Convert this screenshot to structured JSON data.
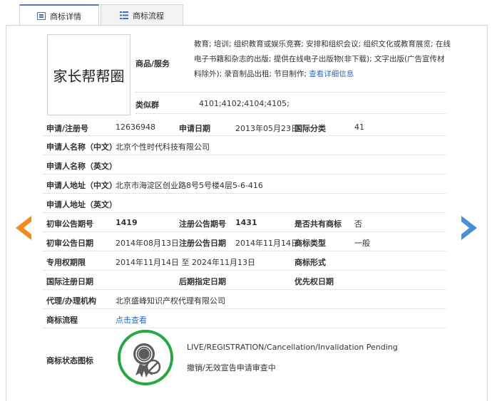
{
  "tabs": [
    {
      "label": "商标详情",
      "icon": "document-icon",
      "active": true
    },
    {
      "label": "商标流程",
      "icon": "list-icon",
      "active": false
    }
  ],
  "trademark": {
    "logo_text": "家长帮帮圈",
    "goods_services_label": "商品/服务",
    "goods_services_text": "教育; 培训; 组织教育或娱乐竞赛; 安排和组织会议; 组织文化或教育展览; 在线电子书籍和杂志的出版; 提供在线电子出版物(非下载); 文字出版(广告宣传材料除外); 录音制品出租; 节目制作;",
    "view_details_link": "查看详细信息",
    "similar_group_label": "类似群",
    "similar_group_value": "4101;4102;4104;4105;"
  },
  "fields": {
    "reg_no_label": "申请/注册号",
    "reg_no": "12636948",
    "apply_date_label": "申请日期",
    "apply_date": "2013年05月23日",
    "intl_class_label": "国际分类",
    "intl_class": "41",
    "applicant_cn_label": "申请人名称（中文）",
    "applicant_cn": "北京个性时代科技有限公司",
    "applicant_en_label": "申请人名称（英文）",
    "applicant_en": "",
    "address_cn_label": "申请人地址（中文）",
    "address_cn": "北京市海淀区创业路8号5号楼4层5-6-416",
    "address_en_label": "申请人地址（英文）",
    "address_en": "",
    "prelim_no_label": "初审公告期号",
    "prelim_no": "1419",
    "reg_pub_no_label": "注册公告期号",
    "reg_pub_no": "1431",
    "shared_label": "是否共有商标",
    "shared": "否",
    "prelim_date_label": "初审公告日期",
    "prelim_date": "2014年08月13日",
    "reg_pub_date_label": "注册公告日期",
    "reg_pub_date": "2014年11月14日",
    "tm_type_label": "商标类型",
    "tm_type": "一般",
    "exclusive_period_label": "专用权期限",
    "exclusive_period": "2014年11月14日 至 2024年11月13日",
    "tm_form_label": "商标形式",
    "tm_form": "",
    "intl_reg_date_label": "国际注册日期",
    "intl_reg_date": "",
    "later_designation_label": "后期指定日期",
    "later_designation": "",
    "priority_date_label": "优先权日期",
    "priority_date": "",
    "agent_label": "代理/办理机构",
    "agent": "北京盛峰知识产权代理有限公司",
    "process_label": "商标流程",
    "process_link": "点击查看",
    "status_icon_label": "商标状态图标",
    "status_en": "LIVE/REGISTRATION/Cancellation/Invalidation Pending",
    "status_cn": "撤销/无效宣告申请审查中"
  },
  "colors": {
    "accent_blue": "#2b6cc4",
    "arrow_left": "#f08c1e",
    "arrow_right": "#4a90d9",
    "seal_green": "#28a745"
  }
}
